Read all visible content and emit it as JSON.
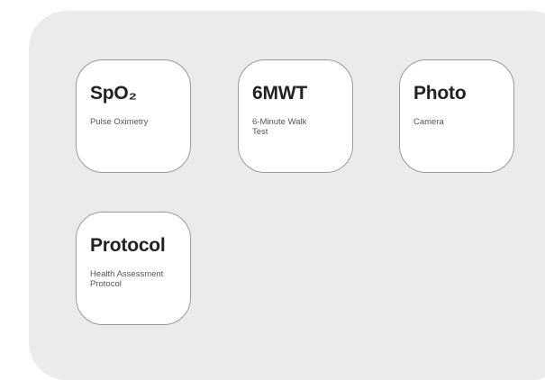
{
  "tiles": [
    {
      "title": "SpO₂",
      "subtitle": "Pulse Oximetry"
    },
    {
      "title": "6MWT",
      "subtitle": "6-Minute Walk Test"
    },
    {
      "title": "Photo",
      "subtitle": "Camera"
    },
    {
      "title": "Protocol",
      "subtitle": "Health Assessment Protocol"
    }
  ],
  "colors": {
    "panel_background": "#ebebeb",
    "tile_background": "#ffffff",
    "tile_border": "#9a9a9a",
    "title_text": "#222222",
    "subtitle_text": "#555555"
  }
}
